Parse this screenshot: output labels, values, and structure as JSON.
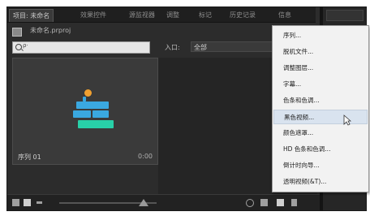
{
  "tabs": [
    "项目: 未命名",
    "效果控件",
    "源监视器",
    "调整",
    "标记",
    "历史记录",
    "信息"
  ],
  "project": {
    "file_name": "未命名.prproj"
  },
  "search": {
    "placeholder": "ρ·"
  },
  "in_label": "入口:",
  "in_value": "全部",
  "thumbnail": {
    "name": "序列 01",
    "duration": "0:00"
  },
  "menu": {
    "items": [
      "序列...",
      "脱机文件...",
      "调整图层...",
      "字幕...",
      "色条和色调...",
      "黑色视频...",
      "颜色遮罩...",
      "HD 色条和色调...",
      "倒计时向导...",
      "透明视频(&T)..."
    ],
    "highlighted_index": 5
  },
  "colors": {
    "orange": "#f0a030",
    "blue": "#3aa8e0",
    "teal": "#28d0a8"
  }
}
